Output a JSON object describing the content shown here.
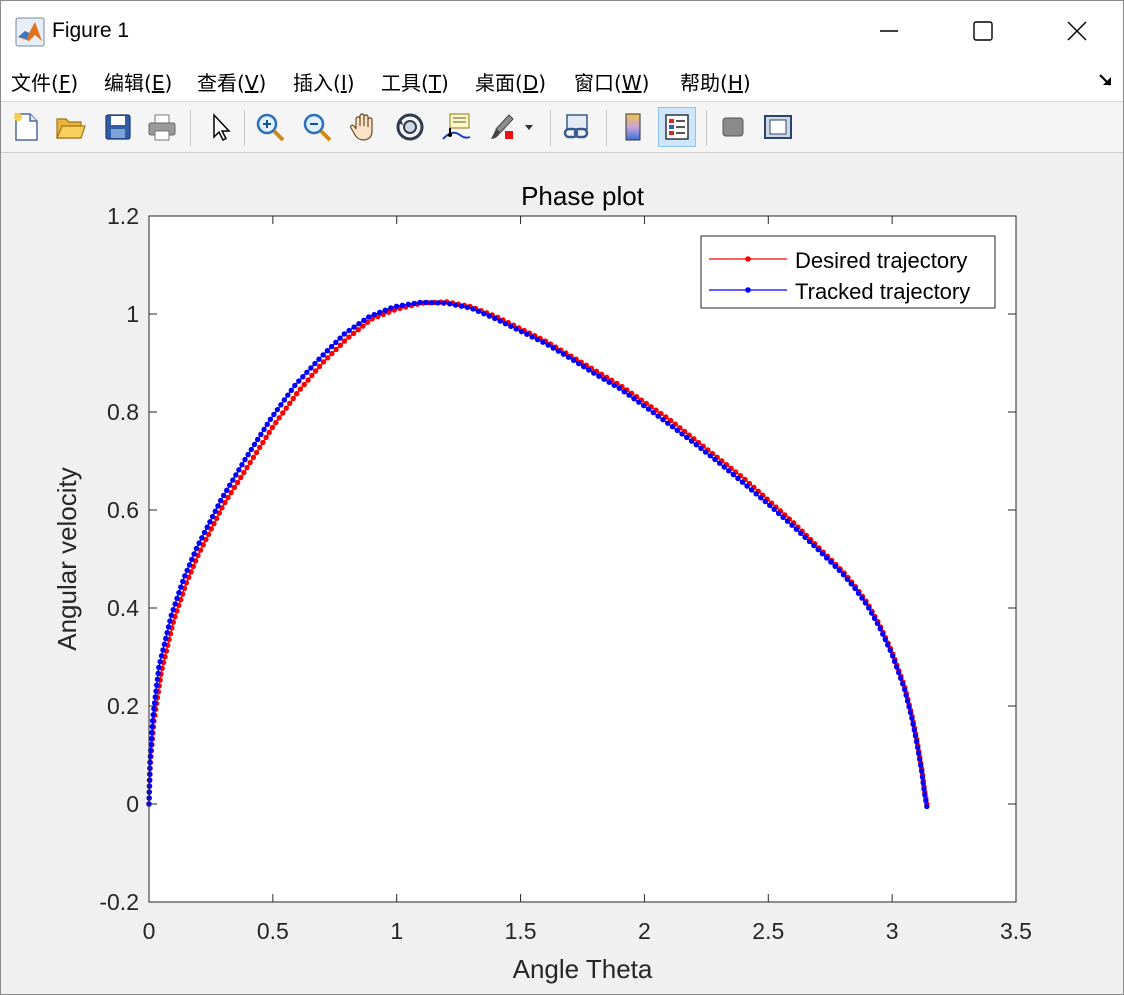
{
  "window": {
    "title": "Figure 1",
    "controls": [
      "minimize",
      "maximize",
      "close"
    ]
  },
  "menu": [
    {
      "pre": "文件(",
      "key": "F",
      "post": ")"
    },
    {
      "pre": "编辑(",
      "key": "E",
      "post": ")"
    },
    {
      "pre": "查看(",
      "key": "V",
      "post": ")"
    },
    {
      "pre": "插入(",
      "key": "I",
      "post": ")"
    },
    {
      "pre": "工具(",
      "key": "T",
      "post": ")"
    },
    {
      "pre": "桌面(",
      "key": "D",
      "post": ")"
    },
    {
      "pre": "窗口(",
      "key": "W",
      "post": ")"
    },
    {
      "pre": "帮助(",
      "key": "H",
      "post": ")"
    }
  ],
  "toolbar": {
    "buttons": [
      "new-figure",
      "open-file",
      "save",
      "print",
      "edit-plot",
      "zoom-in",
      "zoom-out",
      "pan",
      "rotate-3d",
      "data-cursor",
      "brush",
      "link-plot",
      "colorbar",
      "legend",
      "hide-plot-tools",
      "show-plot-tools"
    ],
    "active": "legend"
  },
  "colors": {
    "desired": "#ff0000",
    "tracked": "#0000ff",
    "axes_bg": "#ffffff",
    "figure_bg": "#f0f0f0"
  },
  "chart_data": {
    "type": "line",
    "title": "Phase plot",
    "xlabel": "Angle Theta",
    "ylabel": "Angular velocity",
    "xlim": [
      0,
      3.5
    ],
    "ylim": [
      -0.2,
      1.2
    ],
    "xticks": [
      0,
      0.5,
      1,
      1.5,
      2,
      2.5,
      3,
      3.5
    ],
    "yticks": [
      -0.2,
      0,
      0.2,
      0.4,
      0.6,
      0.8,
      1,
      1.2
    ],
    "xtick_labels": [
      "0",
      "0.5",
      "1",
      "1.5",
      "2",
      "2.5",
      "3",
      "3.5"
    ],
    "ytick_labels": [
      "-0.2",
      "0",
      "0.2",
      "0.4",
      "0.6",
      "0.8",
      "1",
      "1.2"
    ],
    "grid": false,
    "legend_position": "top-right",
    "series": [
      {
        "name": "Desired trajectory",
        "color": "#ff0000",
        "marker": "dot",
        "x": [
          0,
          0.005,
          0.02,
          0.05,
          0.1,
          0.15,
          0.2,
          0.3,
          0.4,
          0.5,
          0.6,
          0.7,
          0.8,
          0.9,
          1.0,
          1.1,
          1.2,
          1.3,
          1.4,
          1.5,
          1.6,
          1.7,
          1.8,
          1.9,
          2.0,
          2.1,
          2.2,
          2.3,
          2.4,
          2.5,
          2.6,
          2.7,
          2.8,
          2.85,
          2.9,
          2.95,
          3.0,
          3.05,
          3.08,
          3.1,
          3.12,
          3.13,
          3.14
        ],
        "y": [
          0.0,
          0.08,
          0.17,
          0.27,
          0.375,
          0.45,
          0.51,
          0.61,
          0.69,
          0.77,
          0.84,
          0.9,
          0.95,
          0.99,
          1.01,
          1.022,
          1.025,
          1.015,
          0.995,
          0.97,
          0.945,
          0.915,
          0.885,
          0.855,
          0.82,
          0.785,
          0.745,
          0.705,
          0.665,
          0.62,
          0.575,
          0.525,
          0.475,
          0.445,
          0.41,
          0.365,
          0.31,
          0.24,
          0.18,
          0.13,
          0.07,
          0.03,
          0.0
        ]
      },
      {
        "name": "Tracked trajectory",
        "color": "#0000ff",
        "marker": "dot",
        "x": [
          0,
          0.004,
          0.015,
          0.04,
          0.09,
          0.14,
          0.19,
          0.29,
          0.39,
          0.49,
          0.59,
          0.69,
          0.79,
          0.89,
          0.99,
          1.1,
          1.2,
          1.3,
          1.4,
          1.5,
          1.6,
          1.7,
          1.8,
          1.9,
          2.0,
          2.1,
          2.2,
          2.3,
          2.4,
          2.5,
          2.6,
          2.7,
          2.8,
          2.85,
          2.9,
          2.95,
          3.0,
          3.05,
          3.08,
          3.1,
          3.12,
          3.13,
          3.14
        ],
        "y": [
          0.0,
          0.085,
          0.175,
          0.28,
          0.385,
          0.46,
          0.52,
          0.62,
          0.705,
          0.785,
          0.855,
          0.91,
          0.96,
          0.995,
          1.015,
          1.024,
          1.022,
          1.012,
          0.99,
          0.965,
          0.94,
          0.91,
          0.878,
          0.848,
          0.812,
          0.775,
          0.737,
          0.697,
          0.655,
          0.612,
          0.567,
          0.52,
          0.47,
          0.44,
          0.405,
          0.36,
          0.305,
          0.235,
          0.175,
          0.125,
          0.065,
          0.025,
          -0.005
        ]
      }
    ]
  }
}
